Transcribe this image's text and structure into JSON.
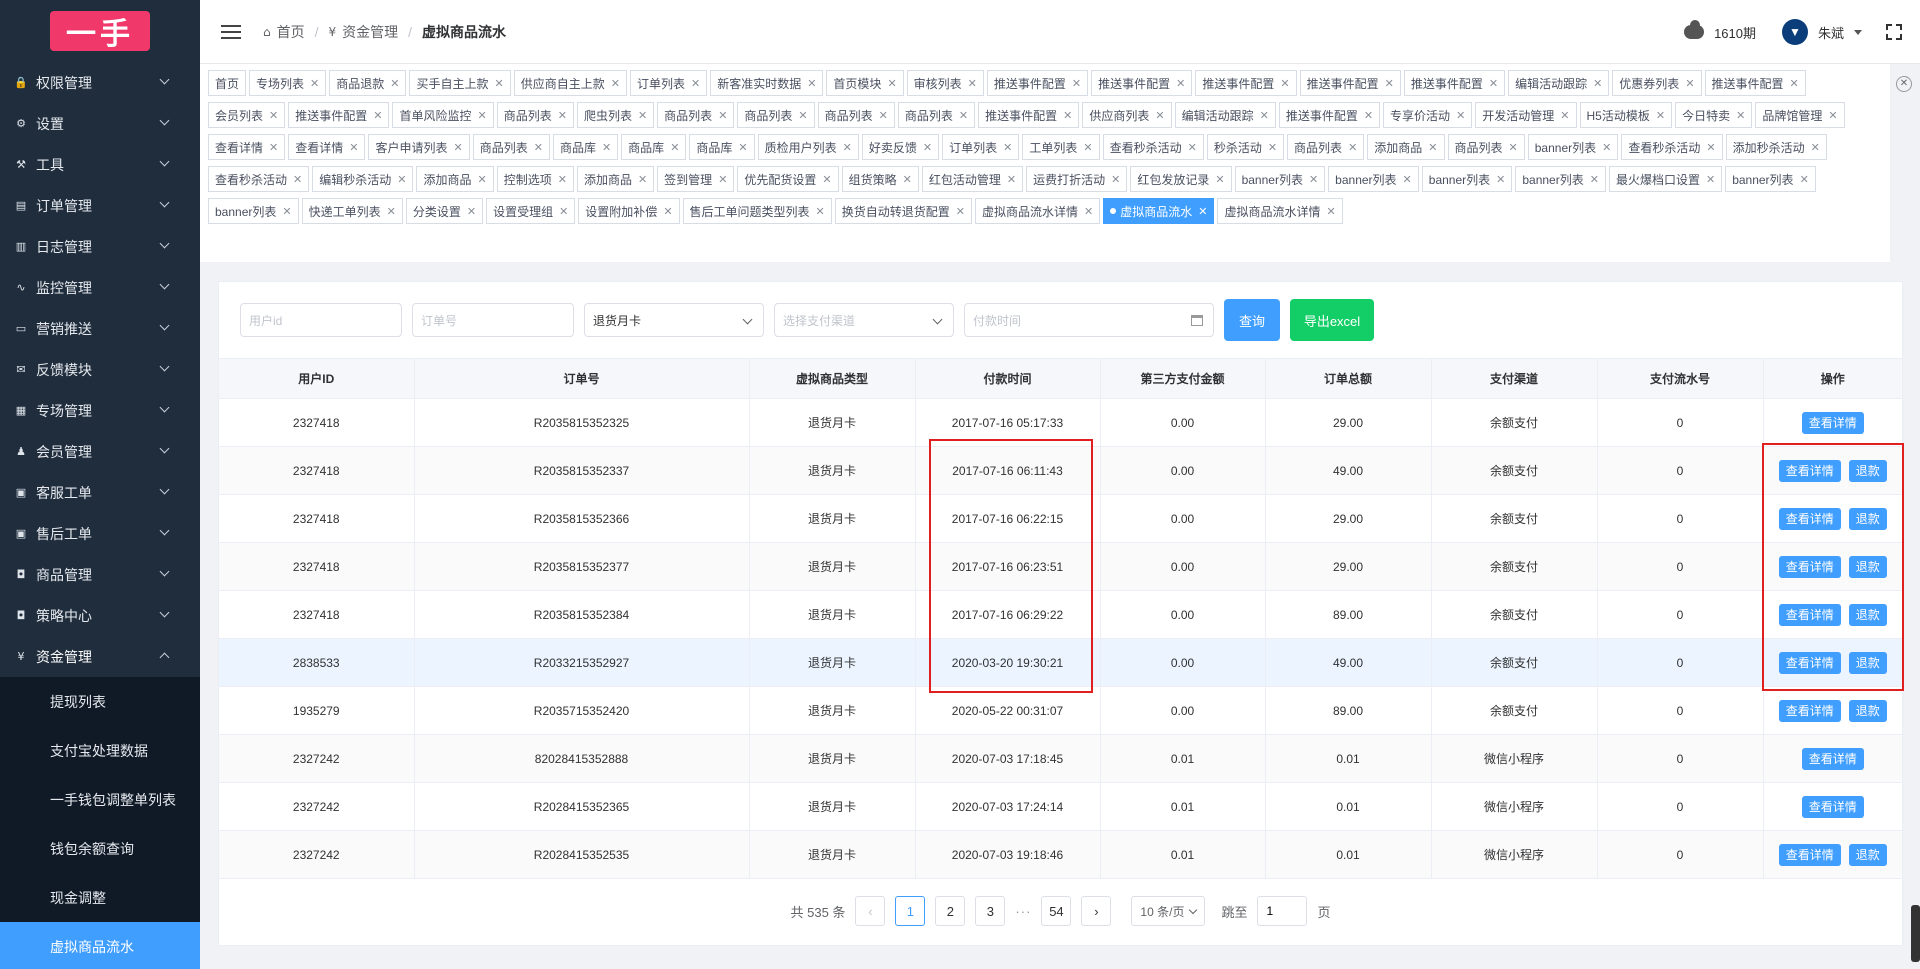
{
  "logo_text": "一手",
  "sidebar": {
    "items": [
      {
        "label": "权限管理",
        "icon": "lock-icon",
        "glyph": "🔒"
      },
      {
        "label": "设置",
        "icon": "gear-icon",
        "glyph": "⚙"
      },
      {
        "label": "工具",
        "icon": "hammer-icon",
        "glyph": "⚒"
      },
      {
        "label": "订单管理",
        "icon": "list-icon",
        "glyph": "▤"
      },
      {
        "label": "日志管理",
        "icon": "document-icon",
        "glyph": "▥"
      },
      {
        "label": "监控管理",
        "icon": "pulse-icon",
        "glyph": "∿"
      },
      {
        "label": "营销推送",
        "icon": "card-icon",
        "glyph": "▭"
      },
      {
        "label": "反馈模块",
        "icon": "mail-icon",
        "glyph": "✉"
      },
      {
        "label": "专场管理",
        "icon": "grid-icon",
        "glyph": "▦"
      },
      {
        "label": "会员管理",
        "icon": "people-icon",
        "glyph": "♟"
      },
      {
        "label": "客服工单",
        "icon": "inbox-icon",
        "glyph": "▣"
      },
      {
        "label": "售后工单",
        "icon": "box-icon",
        "glyph": "▣"
      },
      {
        "label": "商品管理",
        "icon": "bag-icon",
        "glyph": "◘"
      },
      {
        "label": "策略中心",
        "icon": "shirt-icon",
        "glyph": "◘"
      },
      {
        "label": "资金管理",
        "icon": "yen-icon",
        "glyph": "¥"
      }
    ],
    "sub_items": [
      {
        "label": "提现列表"
      },
      {
        "label": "支付宝处理数据"
      },
      {
        "label": "一手钱包调整单列表"
      },
      {
        "label": "钱包余额查询"
      },
      {
        "label": "现金调整"
      },
      {
        "label": "虚拟商品流水",
        "active": true
      }
    ]
  },
  "header": {
    "breadcrumb": [
      {
        "label": "首页",
        "icon": "home-icon",
        "glyph": "⌂"
      },
      {
        "label": "资金管理",
        "icon": "yen-icon",
        "glyph": "¥"
      },
      {
        "label": "虚拟商品流水"
      }
    ],
    "period": "1610期",
    "username": "朱斌"
  },
  "tags": [
    {
      "label": "首页",
      "closable": false
    },
    {
      "label": "专场列表"
    },
    {
      "label": "商品退款"
    },
    {
      "label": "买手自主上款"
    },
    {
      "label": "供应商自主上款"
    },
    {
      "label": "订单列表"
    },
    {
      "label": "新客准实时数据"
    },
    {
      "label": "首页模块"
    },
    {
      "label": "审核列表"
    },
    {
      "label": "推送事件配置"
    },
    {
      "label": "推送事件配置"
    },
    {
      "label": "推送事件配置"
    },
    {
      "label": "推送事件配置"
    },
    {
      "label": "推送事件配置"
    },
    {
      "label": "编辑活动跟踪"
    },
    {
      "label": "优惠券列表"
    },
    {
      "label": "推送事件配置"
    },
    {
      "label": "会员列表"
    },
    {
      "label": "推送事件配置"
    },
    {
      "label": "首单风险监控"
    },
    {
      "label": "商品列表"
    },
    {
      "label": "爬虫列表"
    },
    {
      "label": "商品列表"
    },
    {
      "label": "商品列表"
    },
    {
      "label": "商品列表"
    },
    {
      "label": "商品列表"
    },
    {
      "label": "推送事件配置"
    },
    {
      "label": "供应商列表"
    },
    {
      "label": "编辑活动跟踪"
    },
    {
      "label": "推送事件配置"
    },
    {
      "label": "专享价活动"
    },
    {
      "label": "开发活动管理"
    },
    {
      "label": "H5活动模板"
    },
    {
      "label": "今日特卖"
    },
    {
      "label": "品牌馆管理"
    },
    {
      "label": "查看详情"
    },
    {
      "label": "查看详情"
    },
    {
      "label": "客户申请列表"
    },
    {
      "label": "商品列表"
    },
    {
      "label": "商品库"
    },
    {
      "label": "商品库"
    },
    {
      "label": "商品库"
    },
    {
      "label": "质检用户列表"
    },
    {
      "label": "好卖反馈"
    },
    {
      "label": "订单列表"
    },
    {
      "label": "工单列表"
    },
    {
      "label": "查看秒杀活动"
    },
    {
      "label": "秒杀活动"
    },
    {
      "label": "商品列表"
    },
    {
      "label": "添加商品"
    },
    {
      "label": "商品列表"
    },
    {
      "label": "banner列表"
    },
    {
      "label": "查看秒杀活动"
    },
    {
      "label": "添加秒杀活动"
    },
    {
      "label": "查看秒杀活动"
    },
    {
      "label": "编辑秒杀活动"
    },
    {
      "label": "添加商品"
    },
    {
      "label": "控制选项"
    },
    {
      "label": "添加商品"
    },
    {
      "label": "签到管理"
    },
    {
      "label": "优先配货设置"
    },
    {
      "label": "组货策略"
    },
    {
      "label": "红包活动管理"
    },
    {
      "label": "运费打折活动"
    },
    {
      "label": "红包发放记录"
    },
    {
      "label": "banner列表"
    },
    {
      "label": "banner列表"
    },
    {
      "label": "banner列表"
    },
    {
      "label": "banner列表"
    },
    {
      "label": "最火爆档口设置"
    },
    {
      "label": "banner列表"
    },
    {
      "label": "banner列表"
    },
    {
      "label": "快递工单列表"
    },
    {
      "label": "分类设置"
    },
    {
      "label": "设置受理组"
    },
    {
      "label": "设置附加补偿"
    },
    {
      "label": "售后工单问题类型列表"
    },
    {
      "label": "换货自动转退货配置"
    },
    {
      "label": "虚拟商品流水详情"
    },
    {
      "label": "虚拟商品流水",
      "active": true
    },
    {
      "label": "虚拟商品流水详情"
    }
  ],
  "filters": {
    "user_id_placeholder": "用户id",
    "order_no_placeholder": "订单号",
    "goods_type_value": "退货月卡",
    "pay_channel_placeholder": "选择支付渠道",
    "pay_time_placeholder": "付款时间",
    "search_label": "查询",
    "export_label": "导出excel"
  },
  "table": {
    "columns": [
      "用户ID",
      "订单号",
      "虚拟商品类型",
      "付款时间",
      "第三方支付金额",
      "订单总额",
      "支付渠道",
      "支付流水号",
      "操作"
    ],
    "rows": [
      {
        "user_id": "2327418",
        "order_no": "R2035815352325",
        "type": "退货月卡",
        "pay_time": "2017-07-16 05:17:33",
        "third_amount": "0.00",
        "total": "29.00",
        "channel": "余额支付",
        "serial": "0",
        "refund": false
      },
      {
        "user_id": "2327418",
        "order_no": "R2035815352337",
        "type": "退货月卡",
        "pay_time": "2017-07-16 06:11:43",
        "third_amount": "0.00",
        "total": "49.00",
        "channel": "余额支付",
        "serial": "0",
        "refund": true
      },
      {
        "user_id": "2327418",
        "order_no": "R2035815352366",
        "type": "退货月卡",
        "pay_time": "2017-07-16 06:22:15",
        "third_amount": "0.00",
        "total": "29.00",
        "channel": "余额支付",
        "serial": "0",
        "refund": true
      },
      {
        "user_id": "2327418",
        "order_no": "R2035815352377",
        "type": "退货月卡",
        "pay_time": "2017-07-16 06:23:51",
        "third_amount": "0.00",
        "total": "29.00",
        "channel": "余额支付",
        "serial": "0",
        "refund": true
      },
      {
        "user_id": "2327418",
        "order_no": "R2035815352384",
        "type": "退货月卡",
        "pay_time": "2017-07-16 06:29:22",
        "third_amount": "0.00",
        "total": "89.00",
        "channel": "余额支付",
        "serial": "0",
        "refund": true
      },
      {
        "user_id": "2838533",
        "order_no": "R2033215352927",
        "type": "退货月卡",
        "pay_time": "2020-03-20 19:30:21",
        "third_amount": "0.00",
        "total": "49.00",
        "channel": "余额支付",
        "serial": "0",
        "refund": true,
        "highlight": true
      },
      {
        "user_id": "1935279",
        "order_no": "R2035715352420",
        "type": "退货月卡",
        "pay_time": "2020-05-22 00:31:07",
        "third_amount": "0.00",
        "total": "89.00",
        "channel": "余额支付",
        "serial": "0",
        "refund": true
      },
      {
        "user_id": "2327242",
        "order_no": "82028415352888",
        "type": "退货月卡",
        "pay_time": "2020-07-03 17:18:45",
        "third_amount": "0.01",
        "total": "0.01",
        "channel": "微信小程序",
        "serial": "0",
        "refund": false
      },
      {
        "user_id": "2327242",
        "order_no": "R2028415352365",
        "type": "退货月卡",
        "pay_time": "2020-07-03 17:24:14",
        "third_amount": "0.01",
        "total": "0.01",
        "channel": "微信小程序",
        "serial": "0",
        "refund": false
      },
      {
        "user_id": "2327242",
        "order_no": "R2028415352535",
        "type": "退货月卡",
        "pay_time": "2020-07-03 19:18:46",
        "third_amount": "0.01",
        "total": "0.01",
        "channel": "微信小程序",
        "serial": "0",
        "refund": true
      }
    ],
    "detail_label": "查看详情",
    "refund_label": "退款"
  },
  "pagination": {
    "total_text": "共 535 条",
    "pages": [
      "1",
      "2",
      "3"
    ],
    "ellipsis": "···",
    "last_page": "54",
    "current": "1",
    "page_size": "10 条/页",
    "jump_prefix": "跳至",
    "jump_value": "1",
    "jump_suffix": "页"
  },
  "colors": {
    "primary": "#409eff",
    "success": "#13ce66",
    "sidebar_bg": "#1f2d3d",
    "logo_bg": "#f0386b",
    "annotation": "#e02020"
  }
}
